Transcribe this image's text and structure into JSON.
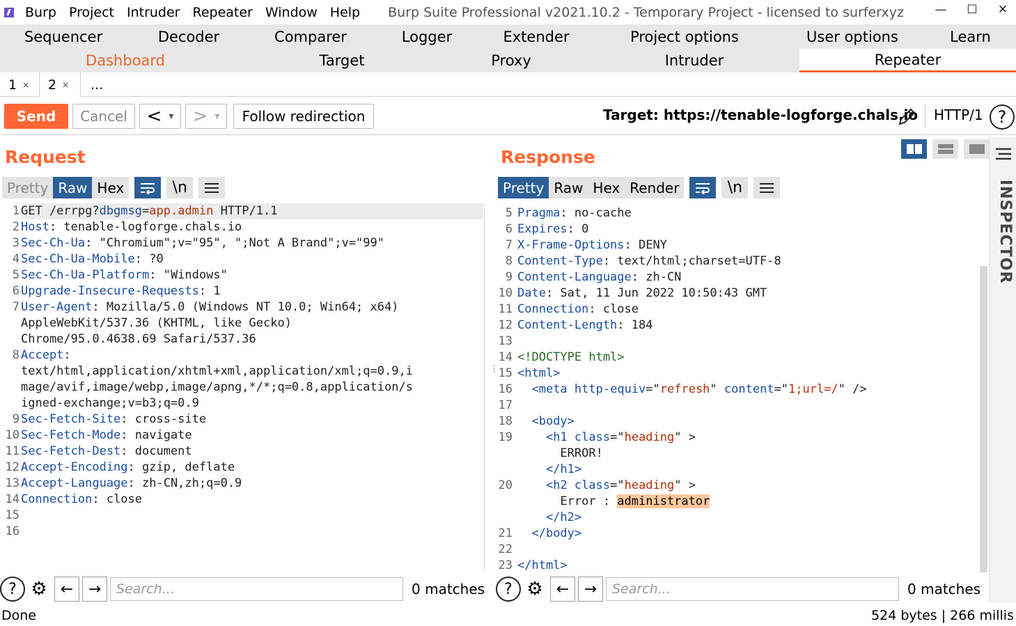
{
  "titlebar": {
    "menu": [
      "Burp",
      "Project",
      "Intruder",
      "Repeater",
      "Window",
      "Help"
    ],
    "title": "Burp Suite Professional v2021.10.2 - Temporary Project - licensed to surferxyz",
    "min": "—",
    "max": "☐",
    "close": "✕"
  },
  "tabs_row1": [
    "Sequencer",
    "Decoder",
    "Comparer",
    "Logger",
    "Extender",
    "Project options",
    "User options",
    "Learn"
  ],
  "tabs_row2": [
    "Dashboard",
    "Target",
    "Proxy",
    "Intruder",
    "Repeater"
  ],
  "subtabs": [
    {
      "label": "1",
      "close": "×"
    },
    {
      "label": "2",
      "close": "×"
    },
    {
      "label": "..."
    }
  ],
  "toolbar": {
    "send": "Send",
    "cancel": "Cancel",
    "back": "<",
    "forward": ">",
    "dropdown": "▾",
    "follow": "Follow redirection",
    "target_label": "Target: https://tenable-logforge.chals.io",
    "http_version": "HTTP/1",
    "help": "?"
  },
  "request": {
    "title": "Request",
    "views": [
      "Pretty",
      "Raw",
      "Hex"
    ],
    "active_view": "Raw",
    "icons": [
      "wrap-icon",
      "newline-icon",
      "menu-icon"
    ],
    "newline_label": "\\n",
    "line_numbers": [
      "1",
      "2",
      "3",
      "4",
      "5",
      "6",
      "7",
      "",
      "",
      "8",
      "",
      "",
      "",
      "9",
      "10",
      "11",
      "12",
      "13",
      "14",
      "15",
      "16"
    ],
    "lines": [
      [
        [
          "t",
          "GET /errpg?"
        ],
        [
          "k",
          "dbgmsg"
        ],
        [
          "t",
          "="
        ],
        [
          "red",
          "app.admin"
        ],
        [
          "t",
          " HTTP/1.1"
        ]
      ],
      [
        [
          "k",
          "Host"
        ],
        [
          "t",
          ": tenable-logforge.chals.io"
        ]
      ],
      [
        [
          "k",
          "Sec-Ch-Ua"
        ],
        [
          "t",
          ": \"Chromium\";v=\"95\", \";Not A Brand\";v=\"99\""
        ]
      ],
      [
        [
          "k",
          "Sec-Ch-Ua-Mobile"
        ],
        [
          "t",
          ": ?0"
        ]
      ],
      [
        [
          "k",
          "Sec-Ch-Ua-Platform"
        ],
        [
          "t",
          ": \"Windows\""
        ]
      ],
      [
        [
          "k",
          "Upgrade-Insecure-Requests"
        ],
        [
          "t",
          ": 1"
        ]
      ],
      [
        [
          "k",
          "User-Agent"
        ],
        [
          "t",
          ": Mozilla/5.0 (Windows NT 10.0; Win64; x64)"
        ]
      ],
      [
        [
          "t",
          "AppleWebKit/537.36 (KHTML, like Gecko)"
        ]
      ],
      [
        [
          "t",
          "Chrome/95.0.4638.69 Safari/537.36"
        ]
      ],
      [
        [
          "k",
          "Accept"
        ],
        [
          "t",
          ":"
        ]
      ],
      [
        [
          "t",
          "text/html,application/xhtml+xml,application/xml;q=0.9,i"
        ]
      ],
      [
        [
          "t",
          "mage/avif,image/webp,image/apng,*/*;q=0.8,application/s"
        ]
      ],
      [
        [
          "t",
          "igned-exchange;v=b3;q=0.9"
        ]
      ],
      [
        [
          "k",
          "Sec-Fetch-Site"
        ],
        [
          "t",
          ": cross-site"
        ]
      ],
      [
        [
          "k",
          "Sec-Fetch-Mode"
        ],
        [
          "t",
          ": navigate"
        ]
      ],
      [
        [
          "k",
          "Sec-Fetch-Dest"
        ],
        [
          "t",
          ": document"
        ]
      ],
      [
        [
          "k",
          "Accept-Encoding"
        ],
        [
          "t",
          ": gzip, deflate"
        ]
      ],
      [
        [
          "k",
          "Accept-Language"
        ],
        [
          "t",
          ": zh-CN,zh;q=0.9"
        ]
      ],
      [
        [
          "k",
          "Connection"
        ],
        [
          "t",
          ": close"
        ]
      ],
      [
        [
          "t",
          ""
        ]
      ],
      [
        [
          "t",
          ""
        ]
      ]
    ]
  },
  "response": {
    "title": "Response",
    "views": [
      "Pretty",
      "Raw",
      "Hex",
      "Render"
    ],
    "active_view": "Pretty",
    "icons": [
      "wrap-icon",
      "newline-icon",
      "menu-icon"
    ],
    "newline_label": "\\n",
    "line_numbers": [
      "5",
      "6",
      "7",
      "8",
      "9",
      "10",
      "11",
      "12",
      "13",
      "14",
      "15",
      "16",
      "17",
      "18",
      "19",
      "",
      "",
      "20",
      "",
      "",
      "21",
      "22",
      "23"
    ],
    "lines": [
      [
        [
          "k",
          "Pragma"
        ],
        [
          "t",
          ": no-cache"
        ]
      ],
      [
        [
          "k",
          "Expires"
        ],
        [
          "t",
          ": 0"
        ]
      ],
      [
        [
          "k",
          "X-Frame-Options"
        ],
        [
          "t",
          ": DENY"
        ]
      ],
      [
        [
          "k",
          "Content-Type"
        ],
        [
          "t",
          ": text/html;charset=UTF-8"
        ]
      ],
      [
        [
          "k",
          "Content-Language"
        ],
        [
          "t",
          ": zh-CN"
        ]
      ],
      [
        [
          "k",
          "Date"
        ],
        [
          "t",
          ": Sat, 11 Jun 2022 10:50:43 GMT"
        ]
      ],
      [
        [
          "k",
          "Connection"
        ],
        [
          "t",
          ": close"
        ]
      ],
      [
        [
          "k",
          "Content-Length"
        ],
        [
          "t",
          ": 184"
        ]
      ],
      [
        [
          "t",
          ""
        ]
      ],
      [
        [
          "grn",
          "<!DOCTYPE html>"
        ]
      ],
      [
        [
          "tag",
          "<html>"
        ]
      ],
      [
        [
          "t",
          "  "
        ],
        [
          "tag",
          "<meta"
        ],
        [
          "t",
          " "
        ],
        [
          "k",
          "http-equiv"
        ],
        [
          "t",
          "=\""
        ],
        [
          "str",
          "refresh"
        ],
        [
          "t",
          "\" "
        ],
        [
          "k",
          "content"
        ],
        [
          "t",
          "=\""
        ],
        [
          "str",
          "1;url=/"
        ],
        [
          "t",
          "\" />"
        ]
      ],
      [
        [
          "t",
          ""
        ]
      ],
      [
        [
          "t",
          "  "
        ],
        [
          "tag",
          "<body>"
        ]
      ],
      [
        [
          "t",
          "    "
        ],
        [
          "tag",
          "<h1"
        ],
        [
          "t",
          " "
        ],
        [
          "k",
          "class"
        ],
        [
          "t",
          "=\""
        ],
        [
          "str",
          "heading"
        ],
        [
          "t",
          "\" >"
        ]
      ],
      [
        [
          "t",
          "      ERROR!"
        ]
      ],
      [
        [
          "t",
          "    "
        ],
        [
          "tag",
          "</h1>"
        ]
      ],
      [
        [
          "t",
          "    "
        ],
        [
          "tag",
          "<h2"
        ],
        [
          "t",
          " "
        ],
        [
          "k",
          "class"
        ],
        [
          "t",
          "=\""
        ],
        [
          "str",
          "heading"
        ],
        [
          "t",
          "\" >"
        ]
      ],
      [
        [
          "t",
          "      Error : "
        ],
        [
          "hl",
          "administrator"
        ]
      ],
      [
        [
          "t",
          "    "
        ],
        [
          "tag",
          "</h2>"
        ]
      ],
      [
        [
          "t",
          "  "
        ],
        [
          "tag",
          "</body>"
        ]
      ],
      [
        [
          "t",
          ""
        ]
      ],
      [
        [
          "tag",
          "</html>"
        ]
      ]
    ]
  },
  "search": {
    "placeholder": "Search...",
    "matches": "0 matches",
    "help": "?",
    "settings": "⚙",
    "prev": "←",
    "next": "→"
  },
  "inspector": {
    "label": "INSPECTOR"
  },
  "status": {
    "left": "Done",
    "right": "524 bytes | 266 millis"
  }
}
